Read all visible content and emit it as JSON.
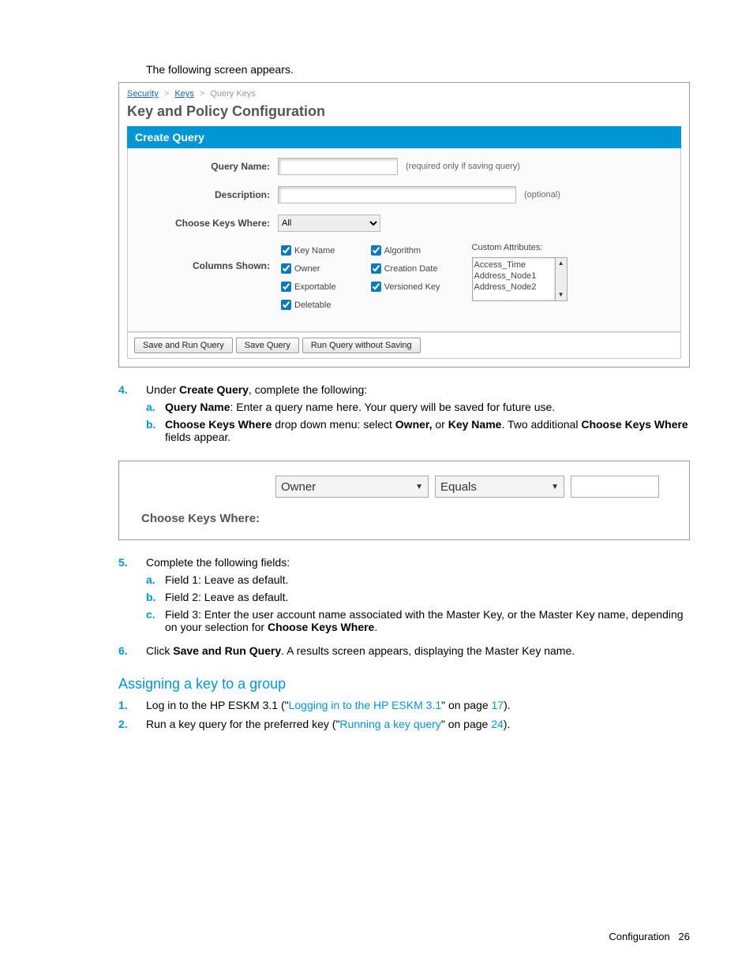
{
  "intro": "The following screen appears.",
  "figure1": {
    "breadcrumb": {
      "a": "Security",
      "b": "Keys",
      "c": "Query Keys"
    },
    "title": "Key and Policy Configuration",
    "panel_header": "Create Query",
    "labels": {
      "query_name": "Query Name:",
      "query_name_hint": "(required only if saving query)",
      "description": "Description:",
      "description_hint": "(optional)",
      "choose_keys_where": "Choose Keys Where:",
      "columns_shown": "Columns Shown:",
      "custom_attributes": "Custom Attributes:"
    },
    "choose_keys_value": "All",
    "checkboxes_col1": [
      "Key Name",
      "Owner",
      "Exportable",
      "Deletable"
    ],
    "checkboxes_col2": [
      "Algorithm",
      "Creation Date",
      "Versioned Key"
    ],
    "custom_attr_items": [
      "Access_Time",
      "Address_Node1",
      "Address_Node2"
    ],
    "buttons": {
      "save_run": "Save and Run Query",
      "save": "Save Query",
      "run_no_save": "Run Query without Saving"
    }
  },
  "step4": {
    "num": "4.",
    "text_a": "Under ",
    "text_b": "Create Query",
    "text_c": ", complete the following:",
    "a": {
      "num": "a.",
      "bold": "Query Name",
      "rest": ": Enter a query name here. Your query will be saved for future use."
    },
    "b": {
      "num": "b.",
      "bold1": "Choose Keys Where",
      "mid1": " drop down menu: select ",
      "bold2": "Owner,",
      "mid2": " or ",
      "bold3": "Key Name",
      "mid3": ". Two additional ",
      "bold4": "Choose Keys Where",
      "end": " fields appear."
    }
  },
  "figure2": {
    "sel1": "Owner",
    "sel2": "Equals",
    "label": "Choose Keys Where:"
  },
  "step5": {
    "num": "5.",
    "text": "Complete the following fields:",
    "a": {
      "num": "a.",
      "text": "Field 1: Leave as default."
    },
    "b": {
      "num": "b.",
      "text": "Field 2: Leave as default."
    },
    "c": {
      "num": "c.",
      "text_a": "Field 3: Enter the user account name associated with the Master Key, or the Master Key name, depending on your selection for ",
      "bold": "Choose Keys Where",
      "text_b": "."
    }
  },
  "step6": {
    "num": "6.",
    "text_a": "Click ",
    "bold": "Save and Run Query",
    "text_b": ". A results screen appears, displaying the Master Key name."
  },
  "heading2": "Assigning a key to a group",
  "assign1": {
    "num": "1.",
    "text_a": "Log in to the HP ESKM 3.1 (\"",
    "link": "Logging in to the HP ESKM 3.1",
    "text_b": "\" on page ",
    "page": "17",
    "text_c": ")."
  },
  "assign2": {
    "num": "2.",
    "text_a": "Run a key query for the preferred key (\"",
    "link": "Running a key query",
    "text_b": "\" on page ",
    "page": "24",
    "text_c": ")."
  },
  "footer": {
    "label": "Configuration",
    "page": "26"
  }
}
